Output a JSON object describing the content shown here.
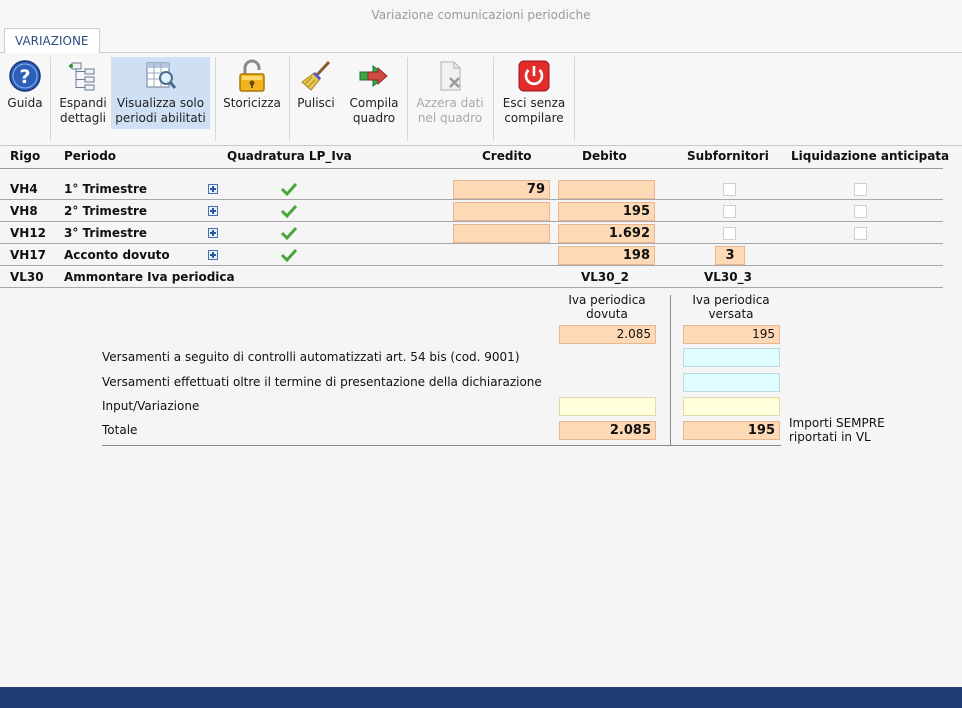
{
  "window": {
    "title": "Variazione comunicazioni periodiche"
  },
  "tabs": [
    {
      "label": "VARIAZIONE"
    }
  ],
  "toolbar": {
    "guida": {
      "line1": "Guida",
      "line2": ""
    },
    "espandi": {
      "line1": "Espandi",
      "line2": "dettagli"
    },
    "visualizza": {
      "line1": "Visualizza solo",
      "line2": "periodi abilitati"
    },
    "storicizza": {
      "line1": "Storicizza",
      "line2": ""
    },
    "pulisci": {
      "line1": "Pulisci",
      "line2": ""
    },
    "compila": {
      "line1": "Compila",
      "line2": "quadro"
    },
    "azzera": {
      "line1": "Azzera dati",
      "line2": "nel quadro"
    },
    "esci": {
      "line1": "Esci senza",
      "line2": "compilare"
    }
  },
  "grid": {
    "headers": {
      "rigo": "Rigo",
      "periodo": "Periodo",
      "quadratura": "Quadratura LP_Iva",
      "credito": "Credito",
      "debito": "Debito",
      "subfornitori": "Subfornitori",
      "liquidazione": "Liquidazione anticipata"
    },
    "rows": [
      {
        "rigo": "VH4",
        "periodo": "1° Trimestre",
        "credito": "79",
        "debito": ""
      },
      {
        "rigo": "VH8",
        "periodo": "2° Trimestre",
        "credito": "",
        "debito": "195"
      },
      {
        "rigo": "VH12",
        "periodo": "3° Trimestre",
        "credito": "",
        "debito": "1.692"
      },
      {
        "rigo": "VH17",
        "periodo": "Acconto dovuto",
        "debito": "198",
        "subfornitori": "3"
      }
    ]
  },
  "vl30": {
    "rigo": "VL30",
    "label": "Ammontare Iva periodica",
    "col2_code": "VL30_2",
    "col3_code": "VL30_3",
    "col2_title_1": "Iva periodica",
    "col2_title_2": "dovuta",
    "col3_title_1": "Iva periodica",
    "col3_title_2": "versata",
    "dovuta": "2.085",
    "versata": "195",
    "versamenti_controlli_label": "Versamenti a seguito di controlli automatizzati art. 54 bis (cod. 9001)",
    "versamenti_oltre_label": "Versamenti effettuati oltre il termine di presentazione della dichiarazione",
    "input_label": "Input/Variazione",
    "totale_label": "Totale",
    "totale_dovuta": "2.085",
    "totale_versata": "195",
    "note_1": "Importi SEMPRE",
    "note_2": "riportati in VL"
  }
}
